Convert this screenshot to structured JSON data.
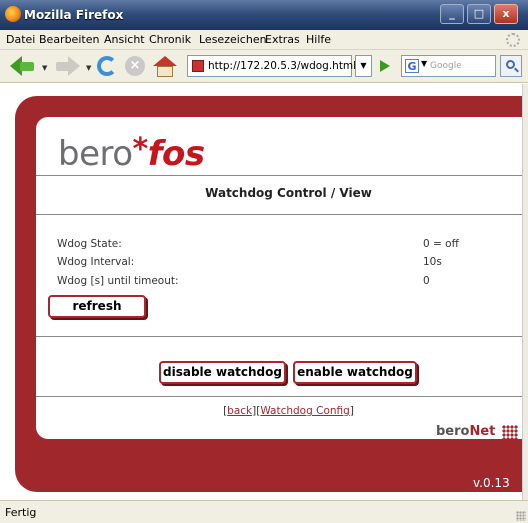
{
  "window": {
    "title": "Mozilla Firefox",
    "controls": [
      "minimize",
      "maximize",
      "close"
    ]
  },
  "menu": [
    "Datei",
    "Bearbeiten",
    "Ansicht",
    "Chronik",
    "Lesezeichen",
    "Extras",
    "Hilfe"
  ],
  "toolbar": {
    "url": "http://172.20.5.3/wdog.html",
    "search_engine": "G",
    "search_placeholder": "Google"
  },
  "page": {
    "logo": {
      "bero": "bero",
      "star": "*",
      "fos": "fos"
    },
    "title": "Watchdog Control / View",
    "rows": [
      {
        "label": "Wdog State:",
        "value": "0 = off"
      },
      {
        "label": "Wdog Interval:",
        "value": "10s"
      },
      {
        "label": "Wdog [s] until timeout:",
        "value": "0"
      }
    ],
    "refresh_label": "refresh",
    "disable_label": "disable watchdog",
    "enable_label": "enable watchdog",
    "links": {
      "open": "[",
      "back": "back",
      "sep": "][",
      "config": "Watchdog Config",
      "close": "]"
    },
    "brand": {
      "part1": "bero",
      "part2": "Net"
    },
    "version": "v.0.13"
  },
  "status": {
    "text": "Fertig"
  },
  "colors": {
    "accent": "#a0272c",
    "logo_red": "#c4161c",
    "logo_gray": "#6d6e71",
    "titlebar": "#314d7c"
  }
}
